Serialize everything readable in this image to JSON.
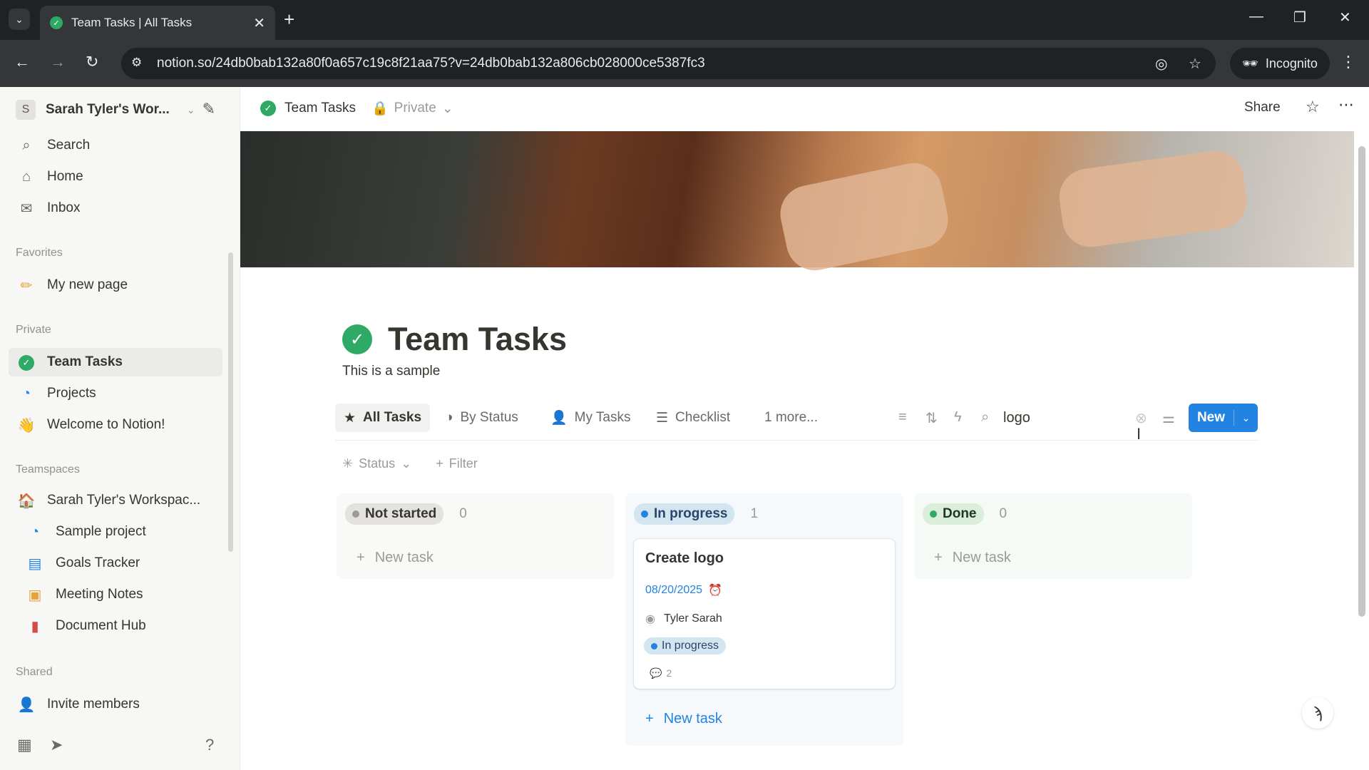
{
  "browser": {
    "tab_title": "Team Tasks | All Tasks",
    "url": "notion.so/24db0bab132a80f0a657c19c8f21aa75?v=24db0bab132a806cb028000ce5387fc3",
    "incognito_label": "Incognito"
  },
  "sidebar": {
    "workspace_initial": "S",
    "workspace_name": "Sarah Tyler's Wor...",
    "nav": [
      {
        "label": "Search",
        "icon": "search-icon"
      },
      {
        "label": "Home",
        "icon": "home-icon"
      },
      {
        "label": "Inbox",
        "icon": "inbox-icon"
      }
    ],
    "favorites_label": "Favorites",
    "favorites": [
      {
        "label": "My new page",
        "icon": "pencil-icon"
      }
    ],
    "private_label": "Private",
    "private_items": [
      {
        "label": "Team Tasks",
        "icon": "check-circle-icon"
      },
      {
        "label": "Projects",
        "icon": "projects-icon"
      },
      {
        "label": "Welcome to Notion!",
        "icon": "wave-icon"
      }
    ],
    "teamspaces_label": "Teamspaces",
    "teamspace_name": "Sarah Tyler's Workspac...",
    "teamspace_items": [
      {
        "label": "Sample project",
        "icon": "projects-icon"
      },
      {
        "label": "Goals Tracker",
        "icon": "chart-icon"
      },
      {
        "label": "Meeting Notes",
        "icon": "calendar-icon"
      },
      {
        "label": "Document Hub",
        "icon": "document-icon"
      }
    ],
    "shared_label": "Shared",
    "invite_label": "Invite members"
  },
  "topbar": {
    "page_name": "Team Tasks",
    "privacy": "Private",
    "share_label": "Share"
  },
  "page": {
    "title": "Team Tasks",
    "description": "This is a sample",
    "views": [
      "All Tasks",
      "By Status",
      "My Tasks",
      "Checklist",
      "1 more..."
    ],
    "search_value": "logo",
    "new_label": "New",
    "filters": {
      "status": "Status",
      "filter": "Filter"
    }
  },
  "board": {
    "columns": [
      {
        "name": "Not started",
        "count": "0",
        "color": "#9b9a97",
        "bg": "#e3e2e0",
        "new_task": "New task"
      },
      {
        "name": "In progress",
        "count": "1",
        "color": "#2383e2",
        "bg": "#d3e5ef",
        "new_task": "New task"
      },
      {
        "name": "Done",
        "count": "0",
        "color": "#2eaa66",
        "bg": "#dbeddb",
        "new_task": "New task"
      }
    ],
    "card": {
      "title": "Create logo",
      "date": "08/20/2025",
      "assignee": "Tyler Sarah",
      "status": "In progress",
      "comments": "2"
    }
  },
  "colors": {
    "accent": "#2383e2",
    "success": "#2eaa66"
  }
}
